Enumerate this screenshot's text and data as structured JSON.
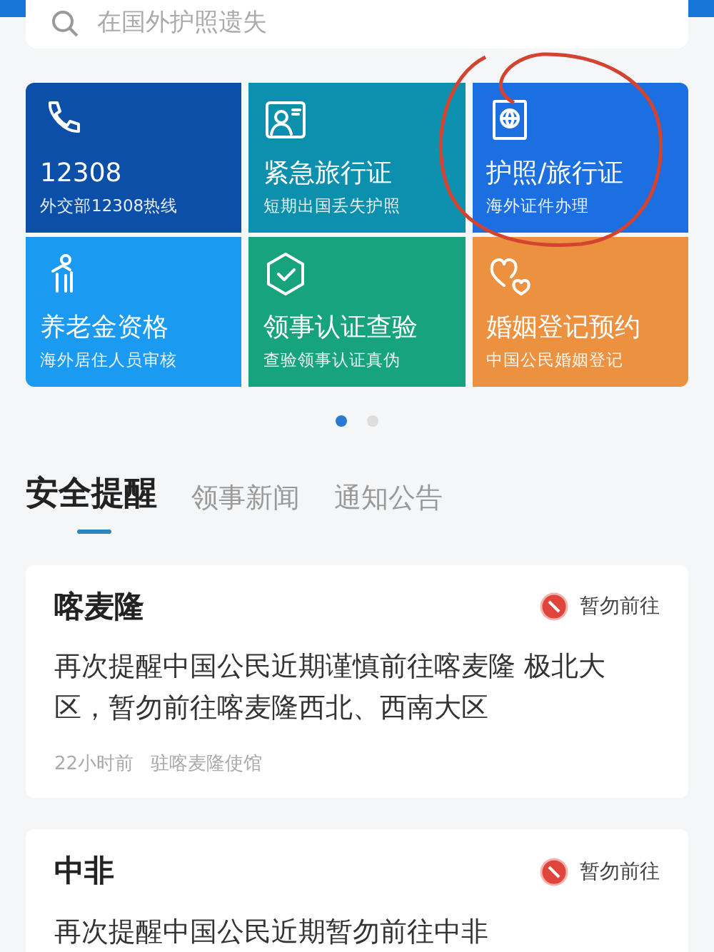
{
  "search": {
    "placeholder": "在国外护照遗失"
  },
  "tiles": [
    {
      "kind": "phone",
      "title": "12308",
      "subtitle": "外交部12308热线",
      "color": "#0c4fa8",
      "circled": false
    },
    {
      "kind": "idcard",
      "title": "紧急旅行证",
      "subtitle": "短期出国丢失护照",
      "color": "#0d8fae",
      "circled": false
    },
    {
      "kind": "passport",
      "title": "护照/旅行证",
      "subtitle": "海外证件办理",
      "color": "#1b6fe0",
      "circled": true
    },
    {
      "kind": "elder",
      "title": "养老金资格",
      "subtitle": "海外居住人员审核",
      "color": "#1a9af0",
      "circled": false
    },
    {
      "kind": "check",
      "title": "领事认证查验",
      "subtitle": "查验领事认证真伪",
      "color": "#16a37e",
      "circled": false
    },
    {
      "kind": "hearts",
      "title": "婚姻登记预约",
      "subtitle": "中国公民婚姻登记",
      "color": "#ec9140",
      "circled": false
    }
  ],
  "pager": [
    {
      "selected": true
    },
    {
      "selected": false
    }
  ],
  "tabs": [
    {
      "label": "安全提醒",
      "selected": true
    },
    {
      "label": "领事新闻",
      "selected": false
    },
    {
      "label": "通知公告",
      "selected": false
    }
  ],
  "alerts": [
    {
      "title": "喀麦隆",
      "badge": "暂勿前往",
      "body": "再次提醒中国公民近期谨慎前往喀麦隆 极北大区，暂勿前往喀麦隆西北、西南大区",
      "time": "22小时前",
      "source": "驻喀麦隆使馆"
    },
    {
      "title": "中非",
      "badge": "暂勿前往",
      "body": "再次提醒中国公民近期暂勿前往中非"
    }
  ]
}
